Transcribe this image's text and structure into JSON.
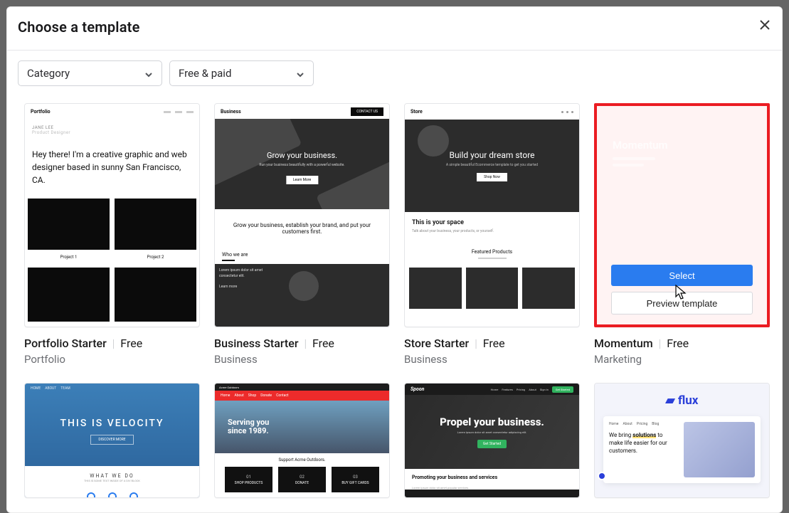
{
  "modal": {
    "title": "Choose a template"
  },
  "filters": {
    "category": "Category",
    "price": "Free & paid"
  },
  "hover_actions": {
    "select": "Select",
    "preview": "Preview template"
  },
  "templates": [
    {
      "name": "Portfolio Starter",
      "price": "Free",
      "category": "Portfolio"
    },
    {
      "name": "Business Starter",
      "price": "Free",
      "category": "Business"
    },
    {
      "name": "Store Starter",
      "price": "Free",
      "category": "Business"
    },
    {
      "name": "Momentum",
      "price": "Free",
      "category": "Marketing"
    }
  ],
  "thumb_text": {
    "portfolio": {
      "brand": "Portfolio",
      "label": "JANE LEE\nProduct Designer",
      "hero": "Hey there! I'm a creative graphic and web designer based in sunny San Francisco, CA.",
      "proj1": "Project 1",
      "proj2": "Project 2"
    },
    "business": {
      "brand": "Business",
      "cta": "CONTACT US",
      "hero": "Grow your business.",
      "hero_btn": "Learn More",
      "mid": "Grow your business, establish your brand, and put your customers first.",
      "who": "Who we are"
    },
    "store": {
      "brand": "Store",
      "hero": "Build your dream store",
      "btn": "Shop Now",
      "space": "This is your space",
      "featured": "Featured Products"
    },
    "momentum": {
      "title": "Momentum"
    },
    "velocity": {
      "hl": "THIS IS VELOCITY",
      "what": "WHAT WE DO"
    },
    "acme": {
      "hero1": "Serving you",
      "hero2": "since 1989.",
      "support": "Support Acme Outdoors.",
      "b1": "SHOP PRODUCTS",
      "b2": "DONATE",
      "b3": "BUY GIFT CARDS",
      "n1": "01",
      "n2": "02",
      "n3": "03"
    },
    "spoon": {
      "brand": "Spoon",
      "hero": "Propel your business.",
      "btn": "Get Started",
      "foot": "Promoting your business and services"
    },
    "flux": {
      "logo": "flux",
      "line1": "We bring ",
      "hl": "solutions",
      "line2": " to make life easier for our customers."
    }
  }
}
